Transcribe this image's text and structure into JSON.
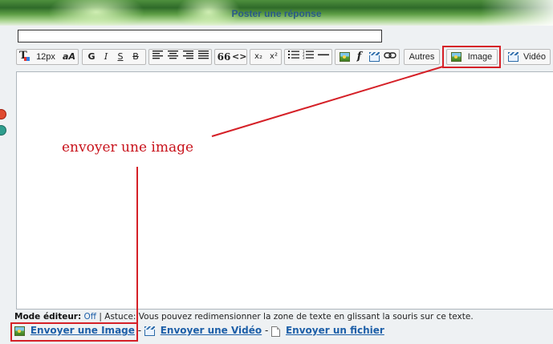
{
  "banner": {
    "title": "Poster une réponse"
  },
  "subject": {
    "value": ""
  },
  "toolbar": {
    "font_size": "12px",
    "font_face": "aA",
    "bold": "G",
    "italic": "I",
    "underline": "S",
    "strike": "B",
    "quote": "66",
    "code": "<>",
    "subscript": "x₂",
    "superscript": "x²",
    "more_label": "Autres",
    "image_label": "Image",
    "video_label": "Vidéo",
    "flash": "f"
  },
  "annotation": {
    "text": "envoyer une image",
    "color": "#c8121b"
  },
  "footer": {
    "mode_label": "Mode éditeur:",
    "mode_value": "Off",
    "tip": "Astuce: Vous pouvez redimensionner la zone de texte en glissant la souris sur ce texte.",
    "send_image": "Envoyer une Image",
    "send_video": "Envoyer une Vidéo",
    "send_file": "Envoyer un fichier",
    "separator": "-",
    "pipe": "|"
  },
  "icons": [
    "text-color-icon",
    "align-left-icon",
    "align-center-icon",
    "align-right-icon",
    "justify-icon",
    "bullet-list-icon",
    "numbered-list-icon",
    "horizontal-rule-icon",
    "image-icon",
    "flash-icon",
    "video-icon",
    "link-icon",
    "document-icon",
    "emoticon-icon"
  ],
  "colors": {
    "link": "#1d5fa8",
    "highlight": "#d52027",
    "banner_text": "#2a5a88"
  }
}
